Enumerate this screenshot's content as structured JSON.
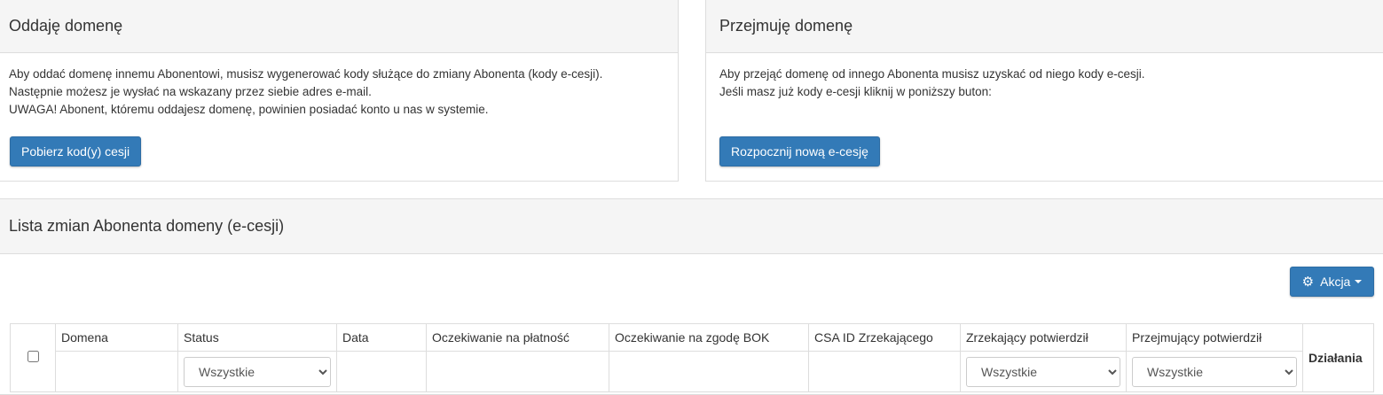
{
  "give_panel": {
    "title": "Oddaję domenę",
    "lines": [
      "Aby oddać domenę innemu Abonentowi, musisz wygenerować kody służące do zmiany Abonenta (kody e-cesji).",
      "Następnie możesz je wysłać na wskazany przez siebie adres e-mail.",
      "UWAGA! Abonent, któremu oddajesz domenę, powinien posiadać konto u nas w systemie."
    ],
    "button": "Pobierz kod(y) cesji"
  },
  "take_panel": {
    "title": "Przejmuję domenę",
    "lines": [
      "Aby przejąć domenę od innego Abonenta musisz uzyskać od niego kody e-cesji.",
      "Jeśli masz już kody e-cesji kliknij w poniższy buton:"
    ],
    "button": "Rozpocznij nową e-cesję"
  },
  "list_panel": {
    "title": "Lista zmian Abonenta domeny (e-cesji)",
    "action_button": "Akcja",
    "action_icon": "gear-icon"
  },
  "table": {
    "headers": {
      "domena": "Domena",
      "status": "Status",
      "data": "Data",
      "payment": "Oczekiwanie na płatność",
      "bok": "Oczekiwanie na zgodę BOK",
      "csa": "CSA ID Zrzekającego",
      "zrzekajacy": "Zrzekający potwierdził",
      "przejmujacy": "Przejmujący potwierdził",
      "dzialania": "Działania"
    },
    "filters": {
      "status": "Wszystkie",
      "zrzekajacy": "Wszystkie",
      "przejmujacy": "Wszystkie"
    }
  },
  "colors": {
    "primary": "#337ab7",
    "panel_header_bg": "#f5f5f5",
    "border": "#dddddd"
  }
}
